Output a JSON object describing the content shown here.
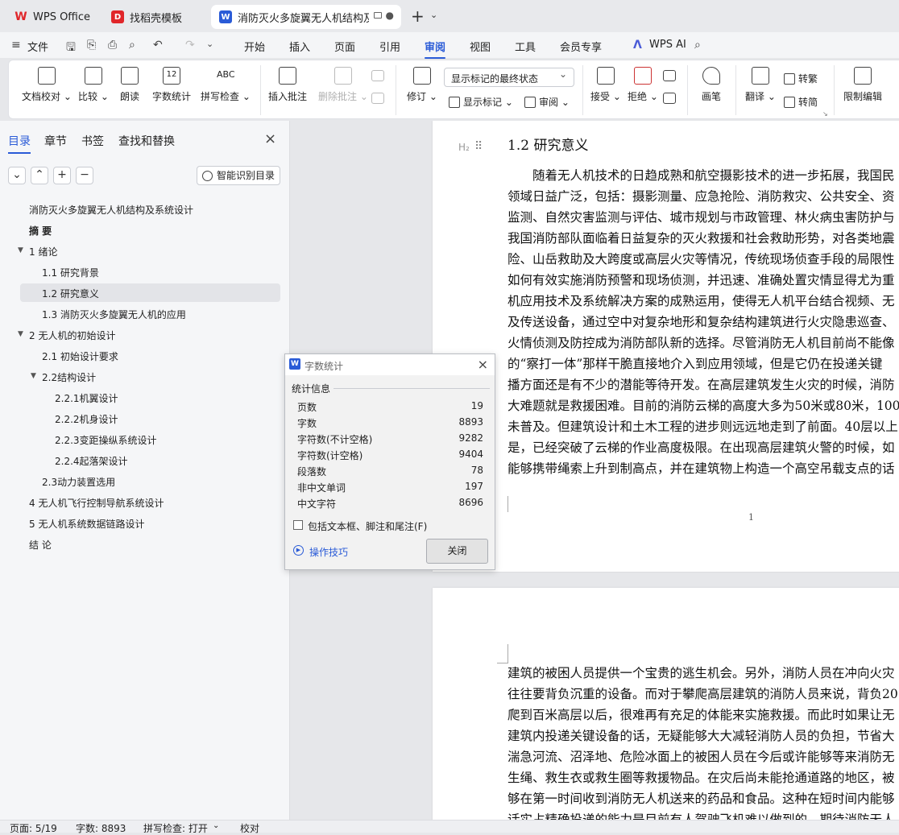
{
  "tabs": [
    {
      "label": "WPS Office"
    },
    {
      "label": "找稻壳模板"
    },
    {
      "label": "消防灭火多旋翼无人机结构及系"
    }
  ],
  "menu": {
    "file": "文件",
    "items": [
      "开始",
      "插入",
      "页面",
      "引用",
      "审阅",
      "视图",
      "工具",
      "会员专享"
    ],
    "active": "审阅",
    "ai": "WPS AI"
  },
  "ribbon": {
    "proof": "文档校对",
    "compare": "比较",
    "read": "朗读",
    "wordcount": "字数统计",
    "spell": "拼写检查",
    "insert_comment": "插入批注",
    "delete_comment": "删除批注",
    "revise": "修订",
    "markup_dropdown": "显示标记的最终状态",
    "show_markup": "显示标记",
    "review": "审阅",
    "accept": "接受",
    "reject": "拒绝",
    "pen": "画笔",
    "translate": "翻译",
    "to_traditional": "转繁",
    "to_simplified": "转简",
    "restrict_edit": "限制编辑",
    "doc_icon_ab": "ABC",
    "doc_icon_12": "12"
  },
  "nav": {
    "tabs": [
      "目录",
      "章节",
      "书签",
      "查找和替换"
    ],
    "smart_btn": "智能识别目录",
    "toc": [
      {
        "label": "消防灭火多旋翼无人机结构及系统设计",
        "indent": 0,
        "tri": false
      },
      {
        "label": "摘 要",
        "indent": 0,
        "tri": false,
        "bold": true
      },
      {
        "label": "1 绪论",
        "indent": 0,
        "tri": true
      },
      {
        "label": "1.1 研究背景",
        "indent": 1,
        "tri": false
      },
      {
        "label": "1.2 研究意义",
        "indent": 1,
        "tri": false,
        "selected": true
      },
      {
        "label": "1.3 消防灭火多旋翼无人机的应用",
        "indent": 1,
        "tri": false
      },
      {
        "label": "2 无人机的初始设计",
        "indent": 0,
        "tri": true
      },
      {
        "label": "2.1 初始设计要求",
        "indent": 1,
        "tri": false
      },
      {
        "label": "2.2结构设计",
        "indent": 1,
        "tri": true
      },
      {
        "label": "2.2.1机翼设计",
        "indent": 2,
        "tri": false
      },
      {
        "label": "2.2.2机身设计",
        "indent": 2,
        "tri": false
      },
      {
        "label": "2.2.3变距操纵系统设计",
        "indent": 2,
        "tri": false
      },
      {
        "label": "2.2.4起落架设计",
        "indent": 2,
        "tri": false
      },
      {
        "label": "2.3动力装置选用",
        "indent": 1,
        "tri": false
      },
      {
        "label": "4 无人机飞行控制导航系统设计",
        "indent": 0,
        "tri": false
      },
      {
        "label": "5 无人机系统数据链路设计",
        "indent": 0,
        "tri": false
      },
      {
        "label": "结 论",
        "indent": 0,
        "tri": false
      }
    ]
  },
  "doc": {
    "heading_tag": "H₂",
    "heading": "1.2 研究意义",
    "page1_lines": [
      "随着无人机技术的日趋成熟和航空摄影技术的进一步拓展，我国民",
      "领域日益广泛，包括：摄影测量、应急抢险、消防救灾、公共安全、资",
      "监测、自然灾害监测与评估、城市规划与市政管理、林火病虫害防护与",
      "我国消防部队面临着日益复杂的灭火救援和社会救助形势，对各类地震",
      "险、山岳救助及大跨度或高层火灾等情况，传统现场侦查手段的局限性",
      "如何有效实施消防预警和现场侦测，并迅速、准确处置灾情显得尤为重",
      "机应用技术及系统解决方案的成熟运用，使得无人机平台结合视频、无",
      "及传送设备，通过空中对复杂地形和复杂结构建筑进行火灾隐患巡查、",
      "火情侦测及防控成为消防部队新的选择。尽管消防无人机目前尚不能像",
      "的“察打一体”那样干脆直接地介入到应用领域，但是它仍在投递关键",
      "播方面还是有不少的潜能等待开发。在高层建筑发生火灾的时候，消防",
      "大难题就是救援困难。目前的消防云梯的高度大多为50米或80米，100",
      "未普及。但建筑设计和土木工程的进步则远远地走到了前面。40层以上",
      "是，已经突破了云梯的作业高度极限。在出现高层建筑火警的时候，如",
      "能够携带绳索上升到制高点，并在建筑物上构造一个高空吊载支点的话"
    ],
    "page_number": "1",
    "page2_lines": [
      "建筑的被困人员提供一个宝贵的逃生机会。另外，消防人员在冲向火灾",
      "往往要背负沉重的设备。而对于攀爬高层建筑的消防人员来说，背负20",
      "爬到百米高层以后，很难再有充足的体能来实施救援。而此时如果让无",
      "建筑内投递关键设备的话，无疑能够大大减轻消防人员的负担，节省大",
      "湍急河流、沼泽地、危险冰面上的被困人员在今后或许能够等来消防无",
      "生绳、救生衣或救生圈等救援物品。在灾后尚未能抢通道路的地区，被",
      "够在第一时间收到消防无人机送来的药品和食品。这种在短时间内能够",
      "话实占精确投递的能力是目前有人驾驶飞机难以做到的，期待消防无人"
    ]
  },
  "dialog": {
    "title": "字数统计",
    "section": "统计信息",
    "rows": [
      {
        "label": "页数",
        "value": "19"
      },
      {
        "label": "字数",
        "value": "8893"
      },
      {
        "label": "字符数(不计空格)",
        "value": "9282"
      },
      {
        "label": "字符数(计空格)",
        "value": "9404"
      },
      {
        "label": "段落数",
        "value": "78"
      },
      {
        "label": "非中文单词",
        "value": "197"
      },
      {
        "label": "中文字符",
        "value": "8696"
      }
    ],
    "checkbox_label": "包括文本框、脚注和尾注(F)",
    "tips": "操作技巧",
    "close": "关闭"
  },
  "status": {
    "page": "页面: 5/19",
    "words": "字数: 8893",
    "spell": "拼写检查: 打开",
    "proof": "校对"
  }
}
